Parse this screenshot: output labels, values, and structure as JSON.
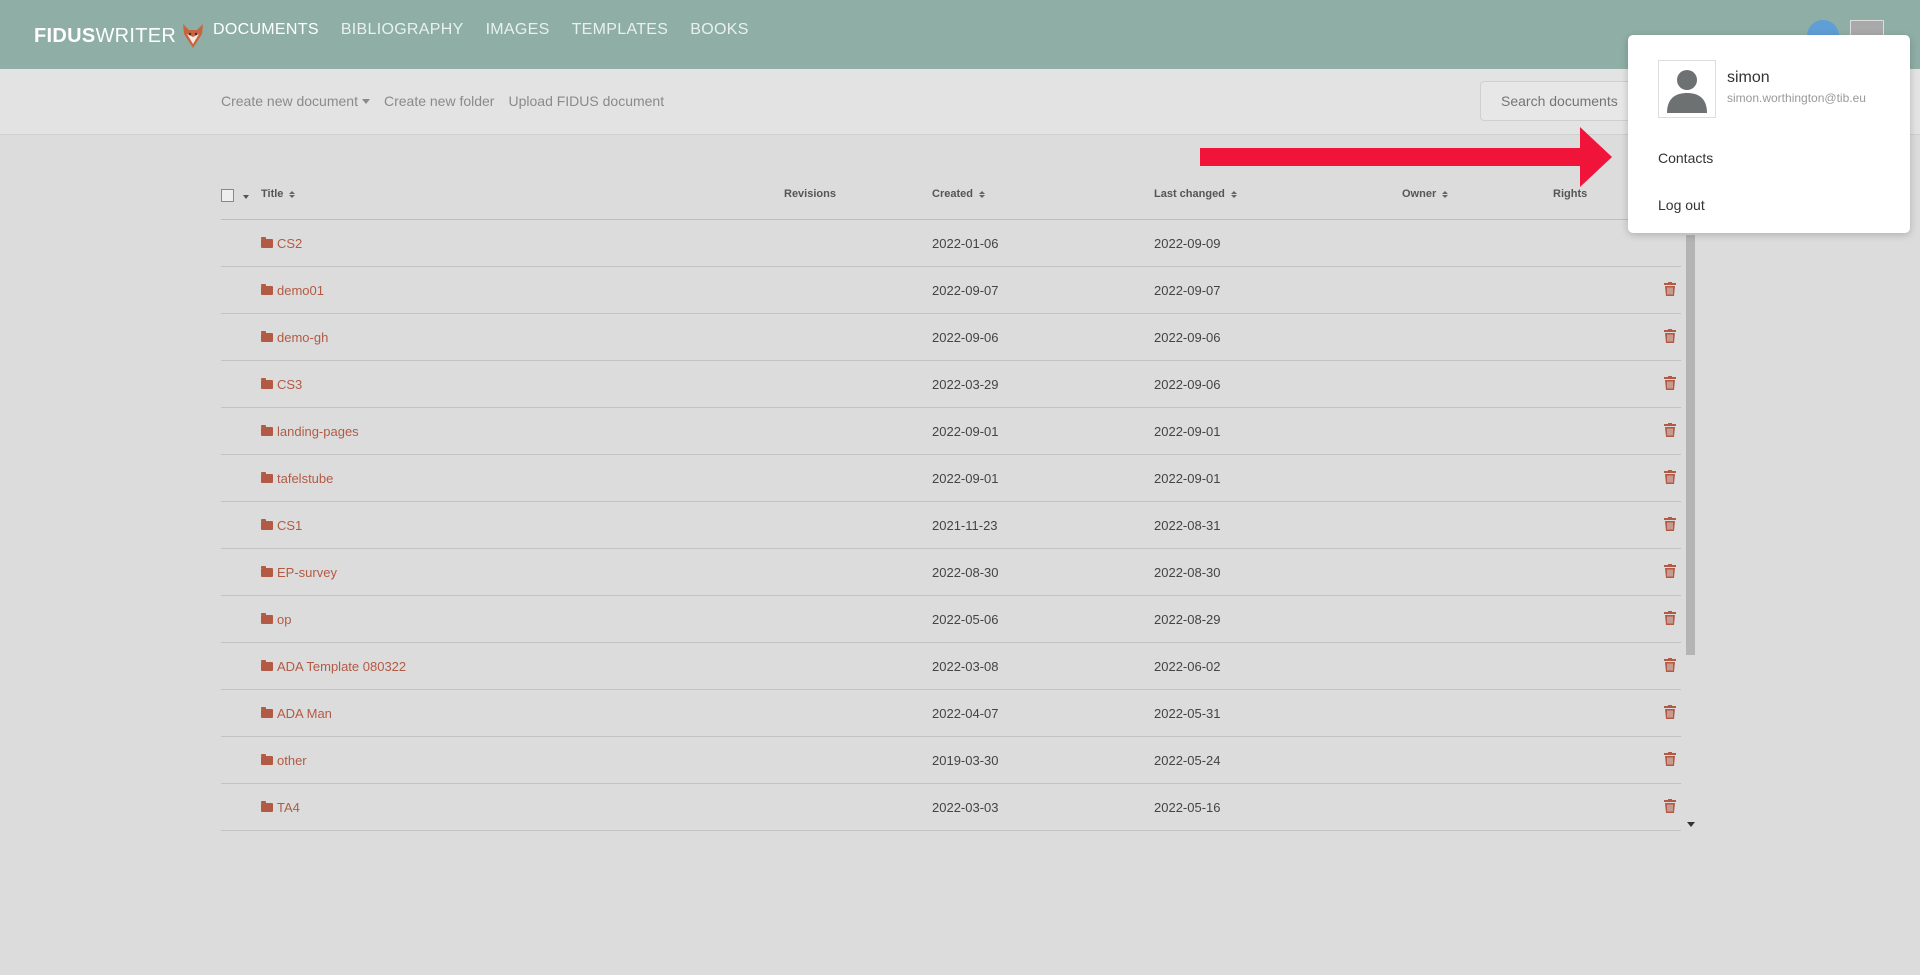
{
  "app": {
    "logo_bold": "FIDUS",
    "logo_light": "WRITER"
  },
  "nav": {
    "items": [
      {
        "label": "DOCUMENTS",
        "active": true
      },
      {
        "label": "BIBLIOGRAPHY",
        "active": false
      },
      {
        "label": "IMAGES",
        "active": false
      },
      {
        "label": "TEMPLATES",
        "active": false
      },
      {
        "label": "BOOKS",
        "active": false
      }
    ]
  },
  "toolbar": {
    "create_document": "Create new document",
    "create_folder": "Create new folder",
    "upload": "Upload FIDUS document",
    "search_placeholder": "Search documents"
  },
  "table": {
    "columns": {
      "title": "Title",
      "revisions": "Revisions",
      "created": "Created",
      "last_changed": "Last changed",
      "owner": "Owner",
      "rights": "Rights"
    },
    "rows": [
      {
        "title": "CS2",
        "created": "2022-01-06",
        "changed": "2022-09-09"
      },
      {
        "title": "demo01",
        "created": "2022-09-07",
        "changed": "2022-09-07"
      },
      {
        "title": "demo-gh",
        "created": "2022-09-06",
        "changed": "2022-09-06"
      },
      {
        "title": "CS3",
        "created": "2022-03-29",
        "changed": "2022-09-06"
      },
      {
        "title": "landing-pages",
        "created": "2022-09-01",
        "changed": "2022-09-01"
      },
      {
        "title": "tafelstube",
        "created": "2022-09-01",
        "changed": "2022-09-01"
      },
      {
        "title": "CS1",
        "created": "2021-11-23",
        "changed": "2022-08-31"
      },
      {
        "title": "EP-survey",
        "created": "2022-08-30",
        "changed": "2022-08-30"
      },
      {
        "title": "op",
        "created": "2022-05-06",
        "changed": "2022-08-29"
      },
      {
        "title": "ADA Template 080322",
        "created": "2022-03-08",
        "changed": "2022-06-02"
      },
      {
        "title": "ADA Man",
        "created": "2022-04-07",
        "changed": "2022-05-31"
      },
      {
        "title": "other",
        "created": "2019-03-30",
        "changed": "2022-05-24"
      },
      {
        "title": "TA4",
        "created": "2022-03-03",
        "changed": "2022-05-16"
      }
    ]
  },
  "user_menu": {
    "username": "simon",
    "email": "simon.worthington@tib.eu",
    "contacts": "Contacts",
    "logout": "Log out"
  },
  "colors": {
    "header": "#8faea6",
    "folder_link": "#b35a44",
    "annotation_arrow": "#f0133a"
  }
}
